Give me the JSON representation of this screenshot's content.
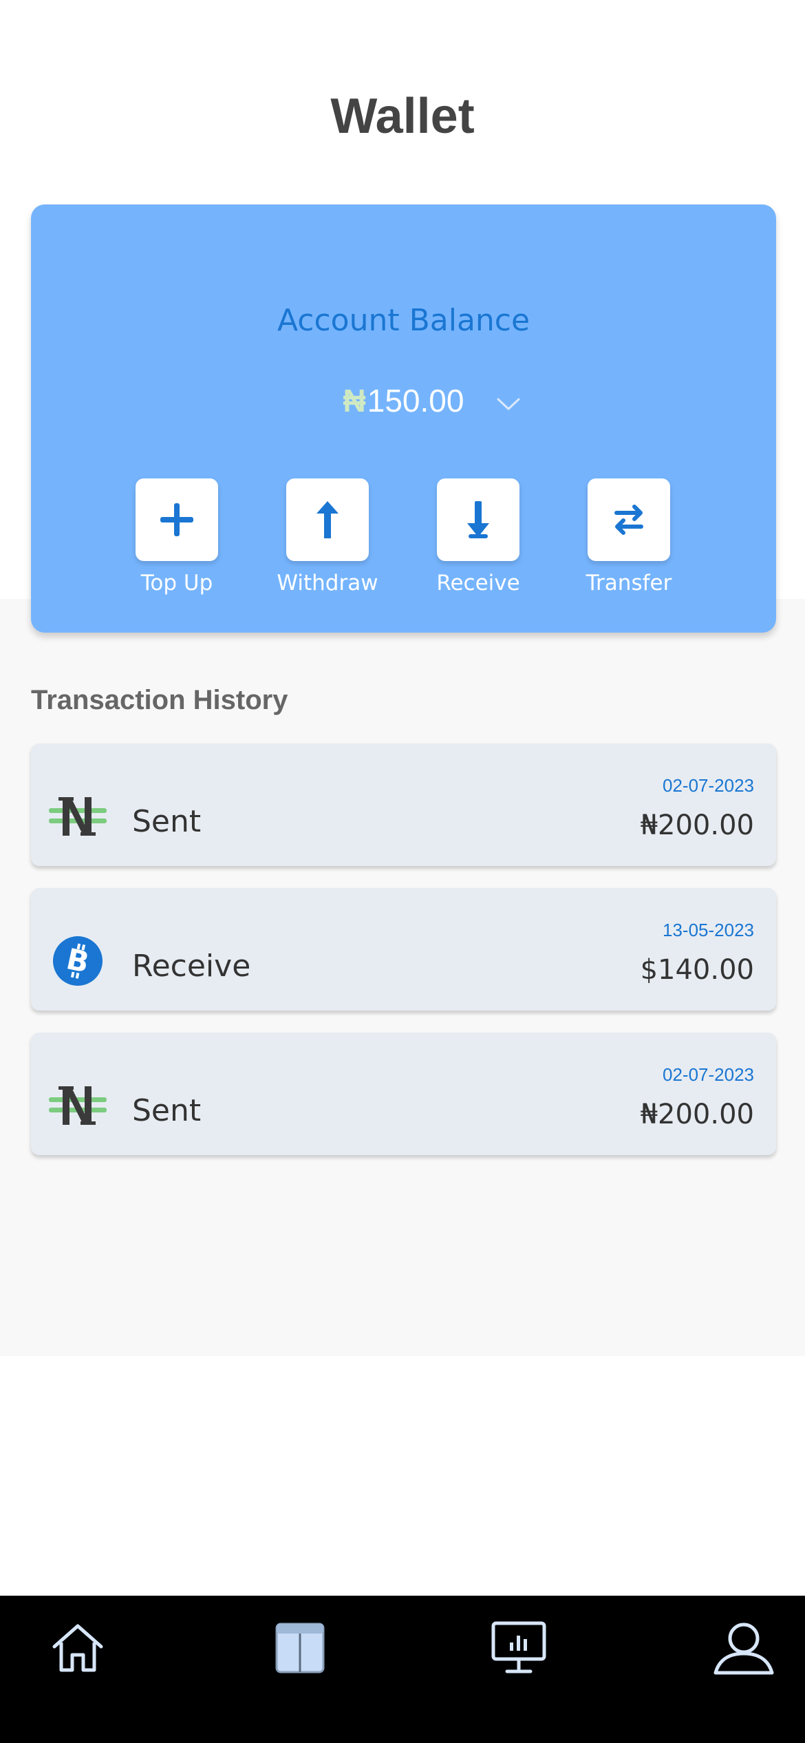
{
  "header": {
    "title": "Wallet"
  },
  "balance": {
    "label": "Account Balance",
    "currency_symbol": "₦",
    "amount": "150.00"
  },
  "actions": [
    {
      "label": "Top Up",
      "icon": "plus-icon"
    },
    {
      "label": "Withdraw",
      "icon": "arrow-up-icon"
    },
    {
      "label": "Receive",
      "icon": "arrow-down-icon"
    },
    {
      "label": "Transfer",
      "icon": "swap-arrows-icon"
    }
  ],
  "history": {
    "title": "Transaction History",
    "items": [
      {
        "type": "Sent",
        "date": "02-07-2023",
        "amount": "₦200.00",
        "icon": "naira-icon"
      },
      {
        "type": "Receive",
        "date": "13-05-2023",
        "amount": "$140.00",
        "icon": "bitcoin-icon"
      },
      {
        "type": "Sent",
        "date": "02-07-2023",
        "amount": "₦200.00",
        "icon": "naira-icon"
      }
    ]
  },
  "tabbar": {
    "items": [
      {
        "icon": "home-icon"
      },
      {
        "icon": "book-icon"
      },
      {
        "icon": "monitor-chart-icon"
      },
      {
        "icon": "user-icon"
      }
    ]
  },
  "colors": {
    "card_bg": "#75b4fd",
    "accent_blue": "#1a76d2",
    "naira_green": "#7ccc7f",
    "tab_bar_bg": "#000000",
    "tab_icon": "#d7e6f8"
  }
}
